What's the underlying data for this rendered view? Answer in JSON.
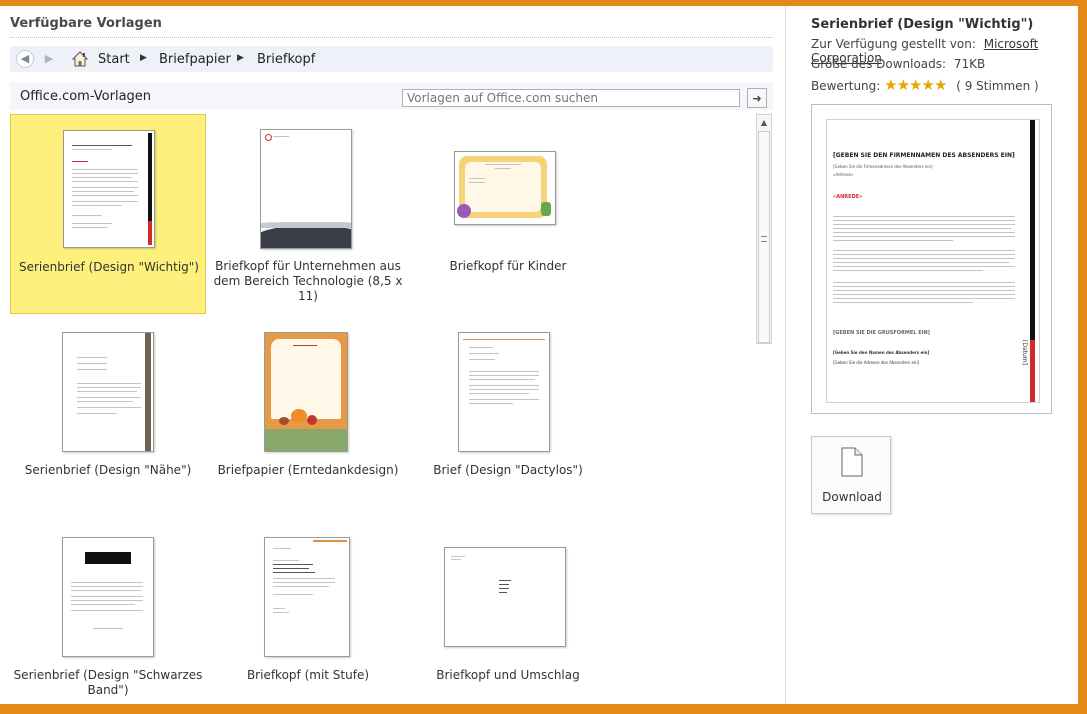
{
  "header": {
    "title": "Verfügbare Vorlagen"
  },
  "breadcrumb": {
    "items": [
      "Start",
      "Briefpapier",
      "Briefkopf"
    ]
  },
  "source": {
    "label": "Office.com-Vorlagen",
    "search_placeholder": "Vorlagen auf Office.com suchen"
  },
  "templates": [
    {
      "label": "Serienbrief (Design \"Wichtig\")"
    },
    {
      "label": "Briefkopf für Unternehmen aus dem Bereich Technologie (8,5 x 11)"
    },
    {
      "label": "Briefkopf für Kinder"
    },
    {
      "label": "Serienbrief (Design \"Nähe\")"
    },
    {
      "label": "Briefpapier (Erntedankdesign)"
    },
    {
      "label": "Brief (Design \"Dactylos\")"
    },
    {
      "label": "Serienbrief (Design \"Schwarzes Band\")"
    },
    {
      "label": "Briefkopf (mit Stufe)"
    },
    {
      "label": "Briefkopf und Umschlag"
    }
  ],
  "details": {
    "title": "Serienbrief (Design \"Wichtig\")",
    "provider_label": "Zur Verfügung gestellt von:",
    "provider": "Microsoft Corporation",
    "size_label": "Größe des Downloads:",
    "size": "71KB",
    "rating_label": "Bewertung:",
    "rating_stars": 5,
    "votes": "( 9 Stimmen )",
    "download_label": "Download"
  },
  "preview_doc": {
    "sender_name": "[GEBEN SIE DEN FIRMENNAMEN DES ABSENDERS EIN]",
    "sender_address": "[Geben Sie die Firmenadresse des Absenders ein]",
    "address_line": "«Adresse»",
    "salutation": "«ANREDE»",
    "closing": "[GEBEN SIE DIE GRUSFORMEL EIN]",
    "signer_name": "[Geben Sie den Namen des Absenders ein]",
    "signer_address": "[Geben Sie die Adresse des Absenders ein]",
    "date_label": "[Datum]"
  },
  "colors": {
    "accent_red": "#d42a2a",
    "selection": "#fdf07c",
    "frame": "#e38a16"
  }
}
